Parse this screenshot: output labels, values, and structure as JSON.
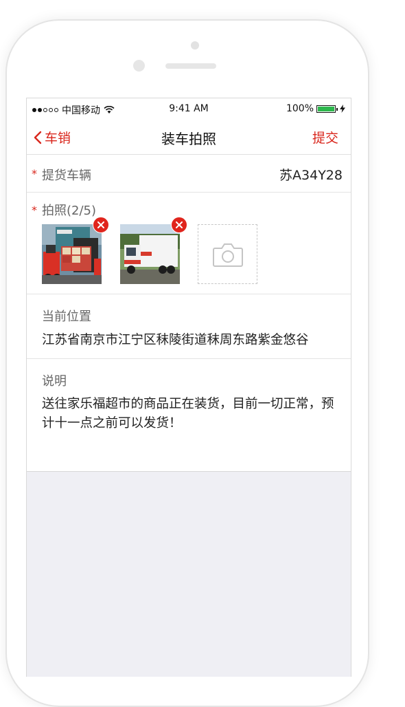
{
  "status_bar": {
    "carrier": "中国移动",
    "time": "9:41 AM",
    "battery": "100%"
  },
  "nav": {
    "back_label": "车销",
    "title": "装车拍照",
    "submit_label": "提交"
  },
  "form": {
    "vehicle": {
      "required_mark": "*",
      "label": "提货车辆",
      "value": "苏A34Y28"
    },
    "photos": {
      "required_mark": "*",
      "label": "拍照(2/5)",
      "count": 2,
      "max": 5
    },
    "location": {
      "label": "当前位置",
      "value": "江苏省南京市江宁区秣陵街道秣周东路紫金悠谷"
    },
    "note": {
      "label": "说明",
      "value": "送往家乐福超市的商品正在装货，目前一切正常，预计十一点之前可以发货！"
    }
  },
  "colors": {
    "accent": "#d9261c",
    "background": "#efeff4"
  }
}
